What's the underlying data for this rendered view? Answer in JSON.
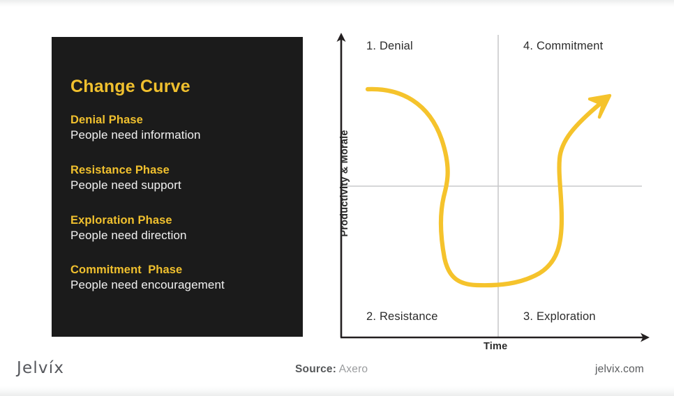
{
  "panel": {
    "title": "Change Curve",
    "phases": [
      {
        "name": "Denial Phase",
        "desc": "People need information"
      },
      {
        "name": "Resistance Phase",
        "desc": "People need support"
      },
      {
        "name": "Exploration Phase",
        "desc": "People need direction"
      },
      {
        "name": "Commitment  Phase",
        "desc": "People need encouragement"
      }
    ]
  },
  "chart_data": {
    "type": "line",
    "title": "Change Curve",
    "xlabel": "Time",
    "ylabel": "Productivity & Morale",
    "xlim": [
      0,
      100
    ],
    "ylim": [
      -100,
      100
    ],
    "grid": true,
    "legend": "none",
    "quadrant_labels": [
      {
        "id": "1",
        "label": "1. Denial",
        "quadrant": "top-left"
      },
      {
        "id": "2",
        "label": "2. Resistance",
        "quadrant": "bottom-left"
      },
      {
        "id": "3",
        "label": "3. Exploration",
        "quadrant": "bottom-right"
      },
      {
        "id": "4",
        "label": "4. Commitment",
        "quadrant": "top-right"
      }
    ],
    "series": [
      {
        "name": "Productivity & Morale over time",
        "color": "#f5c32c",
        "arrow_end": true,
        "x": [
          9,
          16,
          24,
          31,
          36,
          40,
          43,
          44,
          46,
          48,
          50,
          53,
          58,
          65,
          71,
          74,
          75,
          76,
          77,
          79,
          84,
          90
        ],
        "y": [
          62,
          60,
          52,
          36,
          18,
          2,
          -10,
          -24,
          -40,
          -56,
          -66,
          -72,
          -74,
          -73,
          -66,
          -50,
          -30,
          -6,
          14,
          30,
          52,
          80
        ]
      }
    ]
  },
  "footer": {
    "logo": "Jelvíx",
    "source_label": "Source:",
    "source_value": "Axero",
    "site": "jelvix.com"
  },
  "colors": {
    "accent": "#f0c02e",
    "curve": "#f5c32c",
    "panel_bg": "#1b1b1b",
    "axis": "#231f20",
    "grid": "#c9cacb",
    "text_dark": "#2b2b2b",
    "text_light": "#f2f2f2"
  }
}
